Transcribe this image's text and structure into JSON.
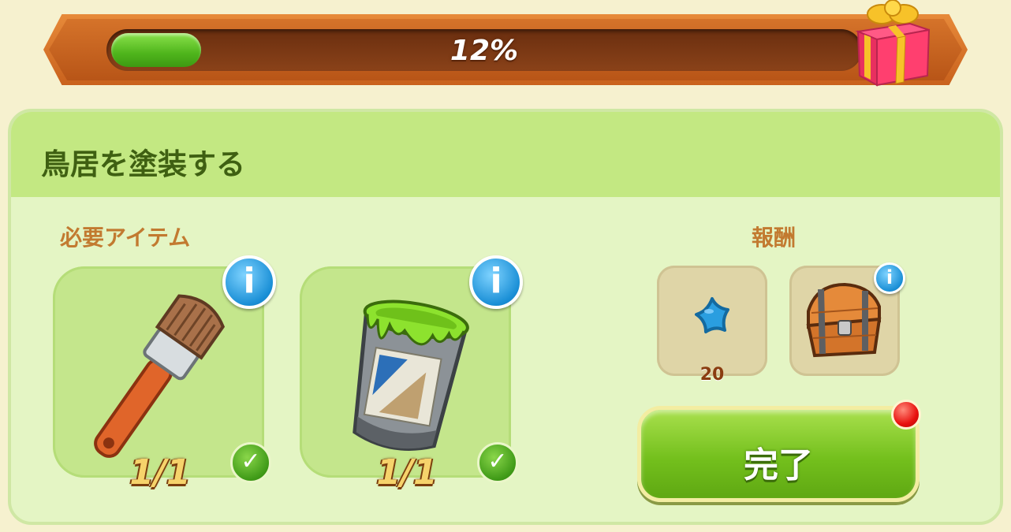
{
  "progress": {
    "fraction": 0.12,
    "label": "12%",
    "reward_icon": "gift-box-icon"
  },
  "task": {
    "title": "鳥居を塗装する",
    "required_label": "必要アイテム",
    "reward_label": "報酬",
    "items": [
      {
        "icon": "paintbrush-icon",
        "count": "1/1",
        "info": "i",
        "complete": true
      },
      {
        "icon": "paint-bucket-icon",
        "count": "1/1",
        "info": "i",
        "complete": true
      }
    ],
    "rewards": [
      {
        "icon": "blue-star-icon",
        "count": "20"
      },
      {
        "icon": "treasure-chest-icon",
        "info": "i"
      }
    ],
    "complete_button": "完了"
  },
  "colors": {
    "progress_fill": "#4fb51c",
    "header_bg": "#c3e882",
    "panel_bg": "#e4f5c4",
    "button_green": "#74c01d",
    "notification": "#e8120f"
  }
}
